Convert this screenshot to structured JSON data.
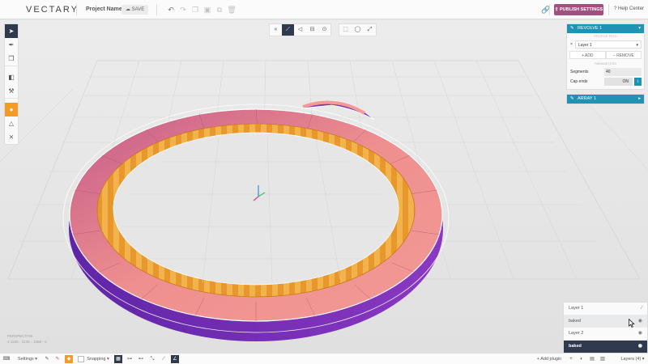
{
  "header": {
    "logo": "VECTARY",
    "project_name": "Project Name",
    "save_label": "SAVE",
    "publish_label": "PUBLISH SETTINGS",
    "help_label": "Help Center"
  },
  "panels": {
    "revolve": {
      "title": "REVOLVE 1",
      "profile_caption": "PROFILE PATH",
      "layer_value": "Layer 1",
      "add_label": "ADD",
      "remove_label": "REMOVE",
      "params_caption": "PARAMETERS",
      "segments_label": "Segments",
      "segments_value": "40",
      "cap_label": "Cap ends",
      "cap_value": "ON"
    },
    "array": {
      "title": "ARRAY 1"
    }
  },
  "viewport": {
    "perspective_label": "PERSPECTIVE",
    "perspective_stats": "4  1536     ◦ 3136    ◦ 1568   ◦ 0"
  },
  "layers": {
    "rows": [
      {
        "name": "Layer 1",
        "icon": "magic-wand-icon"
      },
      {
        "name": "baked",
        "icon": "eye-icon"
      },
      {
        "name": "Layer 2",
        "icon": "eye-icon"
      },
      {
        "name": "baked",
        "icon": "eye-icon"
      }
    ]
  },
  "bottombar": {
    "settings_label": "Settings",
    "snapping_label": "Snapping",
    "add_plugin_label": "Add plugin",
    "layers_label": "Layers (4)"
  },
  "colors": {
    "accent_blue": "#2093b4",
    "publish": "#a1507f",
    "active_tool": "#2f3a4e",
    "orange": "#f49a27"
  }
}
